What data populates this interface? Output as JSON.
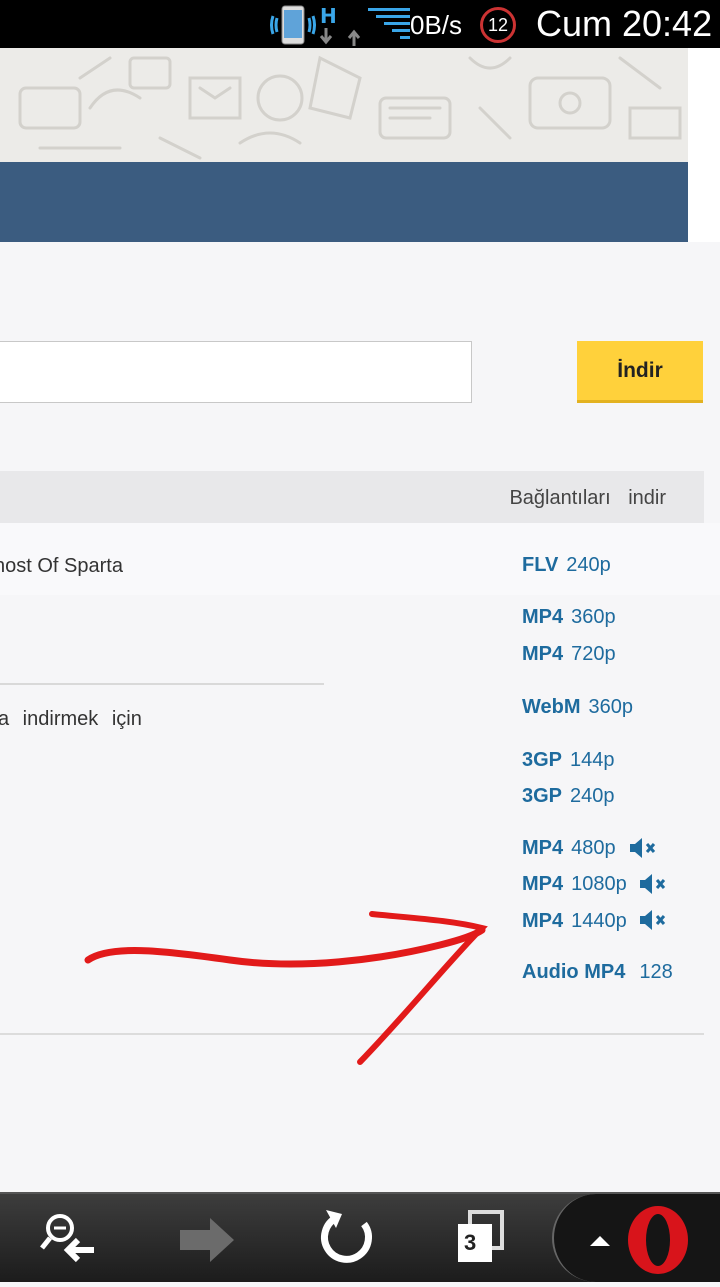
{
  "status_bar": {
    "network_type": "H",
    "speed": "0B/s",
    "notification_count": "12",
    "clock": "Cum 20:42"
  },
  "form": {
    "url_placeholder": "",
    "submit_label": "İndir"
  },
  "table": {
    "header_text": "Bağlantıları indir",
    "video_title": "host Of Sparta",
    "description_fragment": "a indirmek için"
  },
  "downloads": [
    {
      "format": "FLV",
      "quality": "240p",
      "audio": true
    },
    {
      "format": "MP4",
      "quality": "360p",
      "audio": true
    },
    {
      "format": "MP4",
      "quality": "720p",
      "audio": true
    },
    {
      "format": "WebM",
      "quality": "360p",
      "audio": true
    },
    {
      "format": "3GP",
      "quality": "144p",
      "audio": true
    },
    {
      "format": "3GP",
      "quality": "240p",
      "audio": true
    },
    {
      "format": "MP4",
      "quality": "480p",
      "audio": false
    },
    {
      "format": "MP4",
      "quality": "1080p",
      "audio": false
    },
    {
      "format": "MP4",
      "quality": "1440p",
      "audio": false
    },
    {
      "format": "Audio MP4",
      "quality": "128",
      "audio": true
    }
  ],
  "toolbar": {
    "tab_count": "3"
  },
  "colors": {
    "header_band": "#3b5c80",
    "button_yellow": "#ffd13b",
    "link_blue": "#1e6b9e",
    "annotation_red": "#e21a1a",
    "opera_red": "#d8141b"
  }
}
